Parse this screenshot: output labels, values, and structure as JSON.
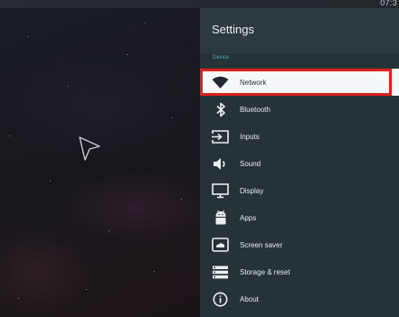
{
  "status_bar": {
    "clock": "07:3"
  },
  "settings": {
    "title": "Settings",
    "section_label": "Device",
    "items": [
      {
        "label": "Network",
        "icon": "wifi-icon",
        "selected": true
      },
      {
        "label": "Bluetooth",
        "icon": "bluetooth-icon",
        "selected": false
      },
      {
        "label": "Inputs",
        "icon": "input-icon",
        "selected": false
      },
      {
        "label": "Sound",
        "icon": "speaker-icon",
        "selected": false
      },
      {
        "label": "Display",
        "icon": "monitor-icon",
        "selected": false
      },
      {
        "label": "Apps",
        "icon": "android-icon",
        "selected": false
      },
      {
        "label": "Screen saver",
        "icon": "screensaver-icon",
        "selected": false
      },
      {
        "label": "Storage & reset",
        "icon": "storage-icon",
        "selected": false
      },
      {
        "label": "About",
        "icon": "info-icon",
        "selected": false
      }
    ]
  },
  "colors": {
    "panel_background": "#263238",
    "accent": "#4db6ac",
    "highlight_border": "#e0201f"
  }
}
